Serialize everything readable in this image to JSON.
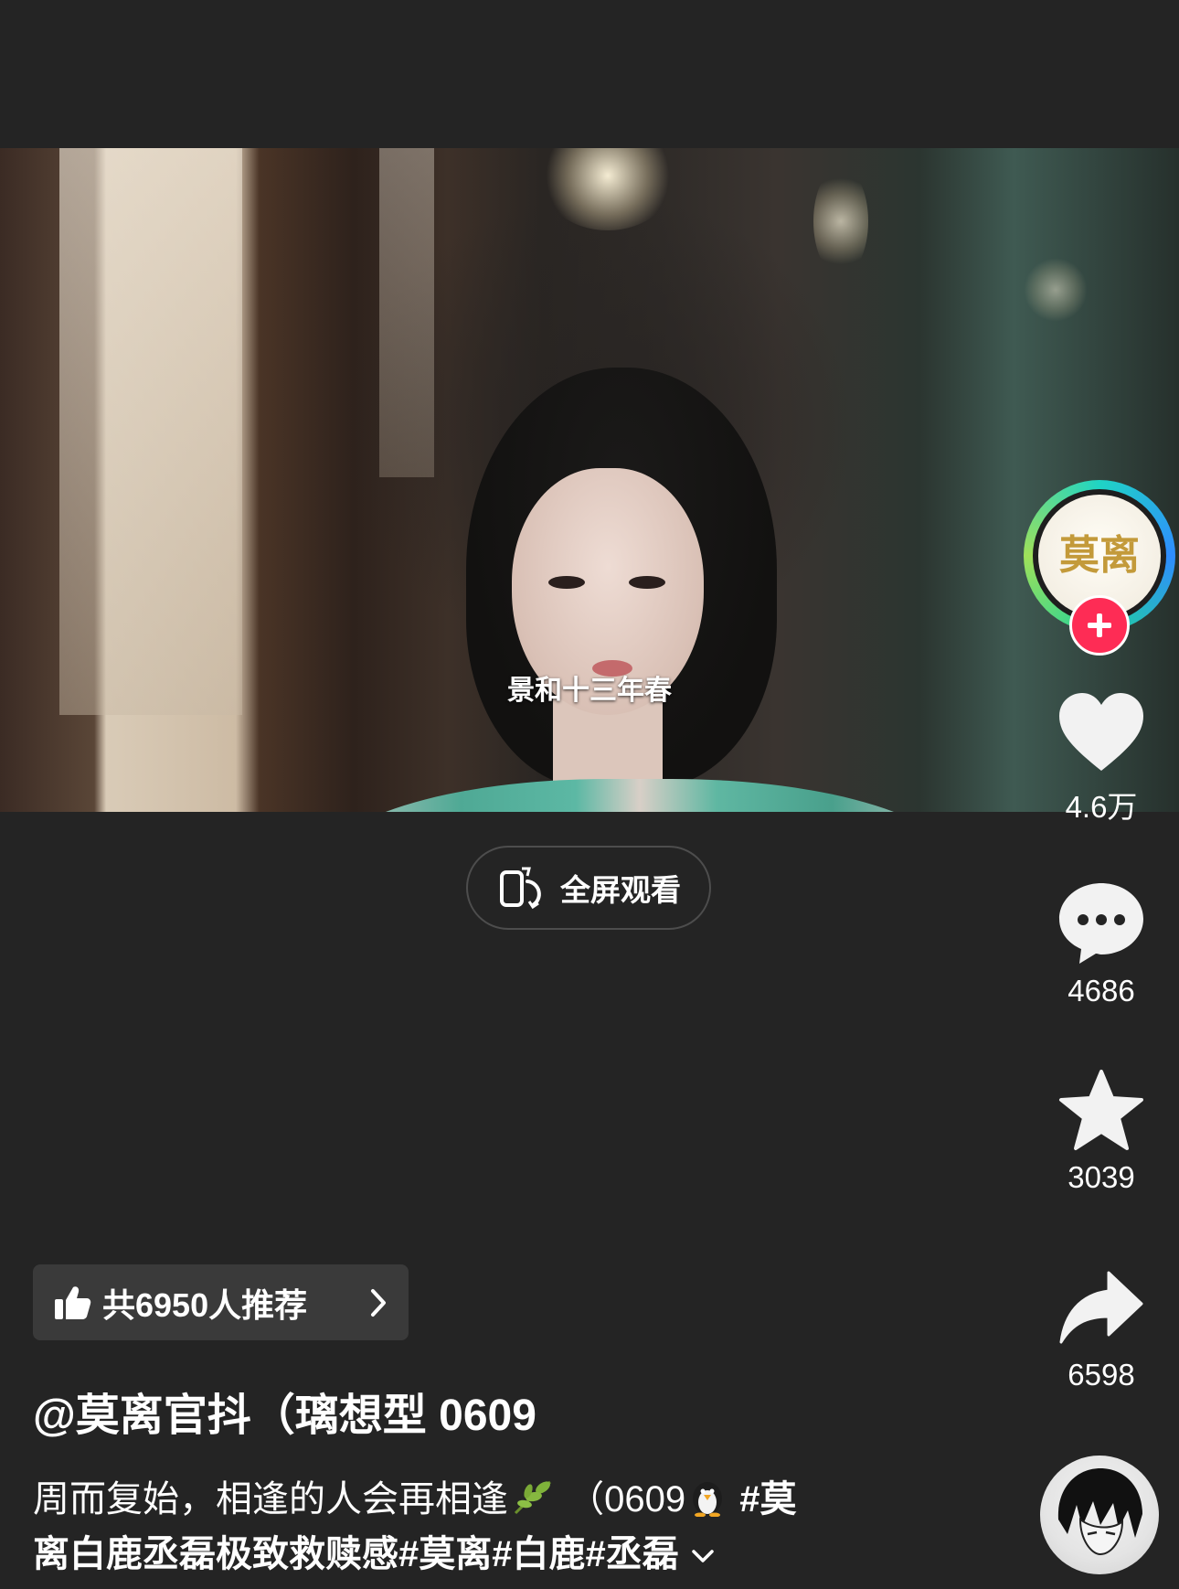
{
  "video": {
    "subtitle": "景和十三年春"
  },
  "fullscreen": {
    "label": "全屏观看"
  },
  "rail": {
    "avatar_text": "莫离",
    "likes": "4.6万",
    "comments": "4686",
    "favorites": "3039",
    "shares": "6598"
  },
  "recommend": {
    "label": "共6950人推荐"
  },
  "author": {
    "handle": "@莫离官抖（璃想型 0609"
  },
  "caption": {
    "line_text": "周而复始，相逢的人会再相逢",
    "mid_text": "（0609",
    "tags": [
      "#莫",
      "离白鹿丞磊极致救赎感#莫离#白鹿#丞磊"
    ]
  },
  "colors": {
    "background": "#242424",
    "follow_red": "#fe2c55",
    "avatar_ring": "#1fd4c4"
  },
  "icons": [
    "phone-rotate-icon",
    "heart-icon",
    "comment-icon",
    "star-icon",
    "share-icon",
    "thumbs-up-icon",
    "chevron-right-icon",
    "chevron-down-icon",
    "leaf-emoji",
    "penguin-emoji",
    "plus-icon"
  ]
}
